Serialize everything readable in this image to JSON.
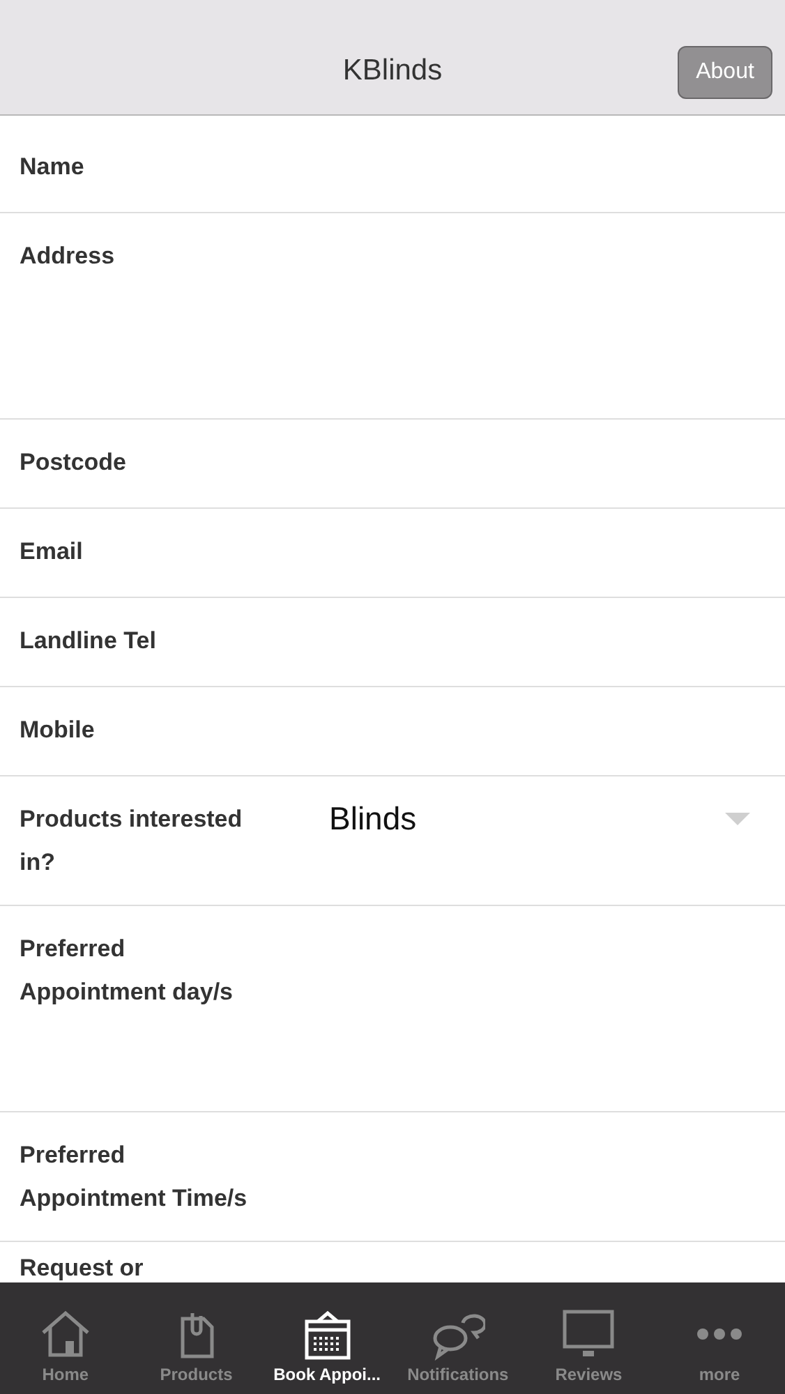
{
  "header": {
    "title": "KBlinds",
    "button": "About"
  },
  "fields": [
    {
      "label": "Name",
      "kind": "text"
    },
    {
      "label": "Address",
      "kind": "textarea"
    },
    {
      "label": "Postcode",
      "kind": "text"
    },
    {
      "label": "Email",
      "kind": "text"
    },
    {
      "label": "Landline Tel",
      "kind": "text"
    },
    {
      "label": "Mobile",
      "kind": "text"
    },
    {
      "label": "Products interested in?",
      "kind": "select",
      "value": "Blinds"
    },
    {
      "label": "Preferred Appointment day/s",
      "kind": "textarea"
    },
    {
      "label": "Preferred Appointment Time/s",
      "kind": "text"
    },
    {
      "label": "Request or",
      "kind": "text"
    }
  ],
  "tabs": [
    {
      "label": "Home",
      "selected": false
    },
    {
      "label": "Products",
      "selected": false
    },
    {
      "label": "Book Appoi...",
      "selected": true
    },
    {
      "label": "Notifications",
      "selected": false
    },
    {
      "label": "Reviews",
      "selected": false
    },
    {
      "label": "more",
      "selected": false
    }
  ]
}
